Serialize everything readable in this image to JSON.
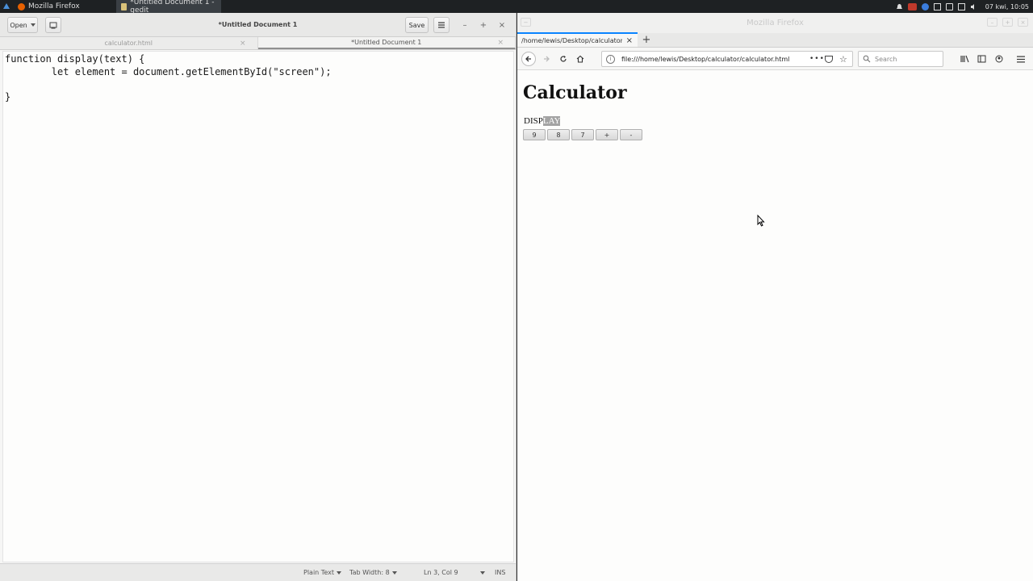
{
  "panel": {
    "tasks": [
      {
        "label": "Mozilla Firefox"
      },
      {
        "label": "*Untitled Document 1 - gedit"
      }
    ],
    "clock": "07 kwi, 10:05"
  },
  "gedit": {
    "open_label": "Open",
    "title": "*Untitled Document 1",
    "save_label": "Save",
    "tabs": [
      {
        "label": "calculator.html"
      },
      {
        "label": "*Untitled Document 1"
      }
    ],
    "code": [
      "function display(text) {",
      "\tlet element = document.getElementById(\"screen\");",
      "",
      "}"
    ],
    "status": {
      "language": "Plain Text",
      "tab_width": "Tab Width: 8",
      "position": "Ln 3, Col 9",
      "mode": "INS"
    }
  },
  "firefox": {
    "window_title": "Mozilla Firefox",
    "tab_label": "/home/lewis/Desktop/calculator/",
    "url": "file:///home/lewis/Desktop/calculator/calculator.html",
    "search_placeholder": "Search",
    "page": {
      "heading": "Calculator",
      "screen_text_plain": "DISP",
      "screen_text_selected": "LAY",
      "buttons": [
        "9",
        "8",
        "7",
        "+",
        "-"
      ]
    }
  },
  "colors": {
    "accent_tab": "#0a84ff",
    "panel_bg": "#1e2123"
  }
}
